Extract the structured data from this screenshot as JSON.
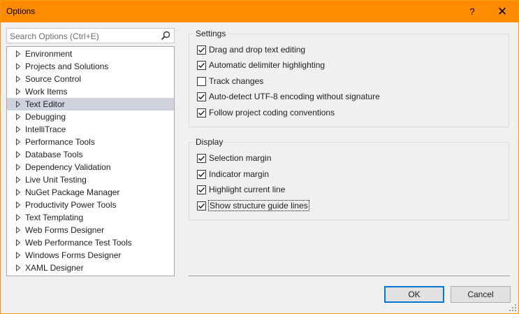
{
  "window": {
    "title": "Options",
    "help_label": "?",
    "close_label": "✕"
  },
  "search": {
    "placeholder": "Search Options (Ctrl+E)"
  },
  "tree": {
    "items": [
      {
        "label": "Environment",
        "selected": false
      },
      {
        "label": "Projects and Solutions",
        "selected": false
      },
      {
        "label": "Source Control",
        "selected": false
      },
      {
        "label": "Work Items",
        "selected": false
      },
      {
        "label": "Text Editor",
        "selected": true
      },
      {
        "label": "Debugging",
        "selected": false
      },
      {
        "label": "IntelliTrace",
        "selected": false
      },
      {
        "label": "Performance Tools",
        "selected": false
      },
      {
        "label": "Database Tools",
        "selected": false
      },
      {
        "label": "Dependency Validation",
        "selected": false
      },
      {
        "label": "Live Unit Testing",
        "selected": false
      },
      {
        "label": "NuGet Package Manager",
        "selected": false
      },
      {
        "label": "Productivity Power Tools",
        "selected": false
      },
      {
        "label": "Text Templating",
        "selected": false
      },
      {
        "label": "Web Forms Designer",
        "selected": false
      },
      {
        "label": "Web Performance Test Tools",
        "selected": false
      },
      {
        "label": "Windows Forms Designer",
        "selected": false
      },
      {
        "label": "XAML Designer",
        "selected": false
      }
    ]
  },
  "settings": {
    "title": "Settings",
    "options": [
      {
        "label": "Drag and drop text editing",
        "checked": true
      },
      {
        "label": "Automatic delimiter highlighting",
        "checked": true
      },
      {
        "label": "Track changes",
        "checked": false
      },
      {
        "label": "Auto-detect UTF-8 encoding without signature",
        "checked": true
      },
      {
        "label": "Follow project coding conventions",
        "checked": true
      }
    ]
  },
  "display": {
    "title": "Display",
    "options": [
      {
        "label": "Selection margin",
        "checked": true
      },
      {
        "label": "Indicator margin",
        "checked": true
      },
      {
        "label": "Highlight current line",
        "checked": true
      },
      {
        "label": "Show structure guide lines",
        "checked": true
      }
    ]
  },
  "buttons": {
    "ok": "OK",
    "cancel": "Cancel"
  }
}
